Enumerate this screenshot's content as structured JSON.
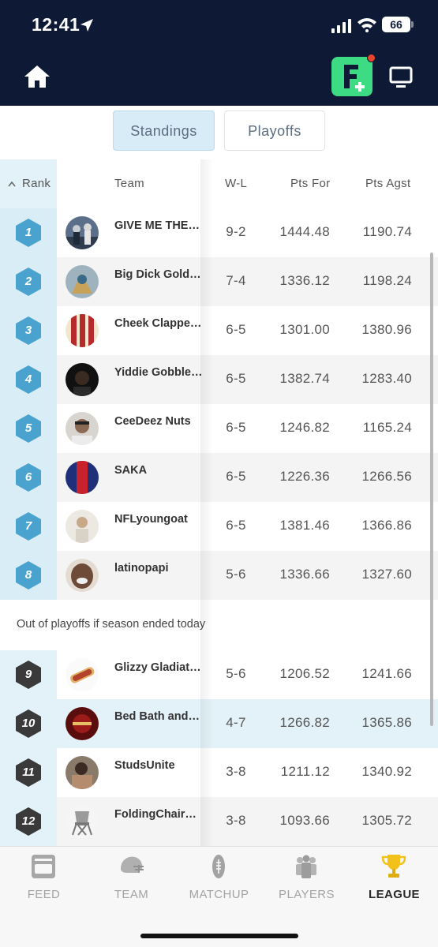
{
  "status": {
    "time": "12:41",
    "battery": "66"
  },
  "tabs": {
    "standings": "Standings",
    "playoffs": "Playoffs"
  },
  "columns": {
    "rank": "Rank",
    "team": "Team",
    "wl": "W-L",
    "pts_for": "Pts For",
    "pts_agst": "Pts Agst"
  },
  "out_label": "Out of playoffs if season ended today",
  "colors": {
    "header_bg": "#0e1a35",
    "accent_green": "#3ddc84",
    "playoff_hex": "#4aa3cf",
    "out_hex": "#3a3a3a"
  },
  "teams": [
    {
      "rank": "1",
      "name": "GIVE ME THE…",
      "wl": "9-2",
      "pf": "1444.48",
      "pa": "1190.74"
    },
    {
      "rank": "2",
      "name": "Big Dick Gold…",
      "wl": "7-4",
      "pf": "1336.12",
      "pa": "1198.24"
    },
    {
      "rank": "3",
      "name": "Cheek Clappe…",
      "wl": "6-5",
      "pf": "1301.00",
      "pa": "1380.96"
    },
    {
      "rank": "4",
      "name": "Yiddie Gobble…",
      "wl": "6-5",
      "pf": "1382.74",
      "pa": "1283.40"
    },
    {
      "rank": "5",
      "name": "CeeDeez Nuts",
      "wl": "6-5",
      "pf": "1246.82",
      "pa": "1165.24"
    },
    {
      "rank": "6",
      "name": "SAKA",
      "wl": "6-5",
      "pf": "1226.36",
      "pa": "1266.56"
    },
    {
      "rank": "7",
      "name": "NFLyoungoat",
      "wl": "6-5",
      "pf": "1381.46",
      "pa": "1366.86"
    },
    {
      "rank": "8",
      "name": "latinopapi",
      "wl": "5-6",
      "pf": "1336.66",
      "pa": "1327.60"
    },
    {
      "rank": "9",
      "name": "Glizzy Gladiat…",
      "wl": "5-6",
      "pf": "1206.52",
      "pa": "1241.66"
    },
    {
      "rank": "10",
      "name": "Bed Bath and…",
      "wl": "4-7",
      "pf": "1266.82",
      "pa": "1365.86"
    },
    {
      "rank": "11",
      "name": "StudsUnite",
      "wl": "3-8",
      "pf": "1211.12",
      "pa": "1340.92"
    },
    {
      "rank": "12",
      "name": "FoldingChair…",
      "wl": "3-8",
      "pf": "1093.66",
      "pa": "1305.72"
    }
  ],
  "bottom_nav": [
    {
      "label": "FEED",
      "icon": "feed-icon"
    },
    {
      "label": "TEAM",
      "icon": "helmet-icon"
    },
    {
      "label": "MATCHUP",
      "icon": "football-icon"
    },
    {
      "label": "PLAYERS",
      "icon": "players-icon"
    },
    {
      "label": "LEAGUE",
      "icon": "trophy-icon",
      "active": true
    }
  ]
}
